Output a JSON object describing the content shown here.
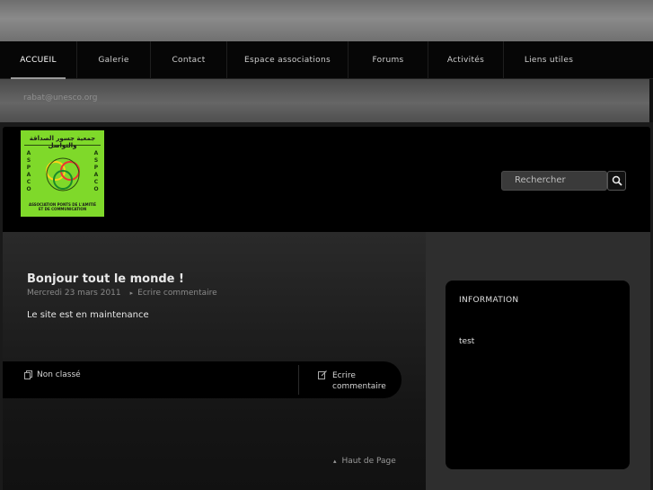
{
  "nav": {
    "items": [
      {
        "label": "ACCUEIL",
        "active": true
      },
      {
        "label": "Galerie",
        "active": false
      },
      {
        "label": "Contact",
        "active": false
      },
      {
        "label": "Espace associations",
        "active": false
      },
      {
        "label": "Forums",
        "active": false
      },
      {
        "label": "Activités",
        "active": false
      },
      {
        "label": "Liens utiles",
        "active": false
      }
    ]
  },
  "infobar": {
    "email": "rabat@unesco.org"
  },
  "logo": {
    "arabic_text": "جمعية جسور الصداقة والتواصل",
    "left_vertical": "ASPACO",
    "right_vertical": "ASPACO",
    "caption": "ASSOCIATION PONTS DE L'AMITIÉ ET DE COMMUNICATION",
    "background_color": "#7fd92a"
  },
  "search": {
    "placeholder": "Rechercher",
    "button_icon": "search-icon"
  },
  "post": {
    "title": "Bonjour tout le monde !",
    "date": "Mercredi 23 mars 2011",
    "comment_meta": "Ecrire commentaire",
    "body": "Le site est en maintenance",
    "category": "Non classé",
    "comment_link_line1": "Ecrire",
    "comment_link_line2": "commentaire"
  },
  "footer": {
    "back_to_top": "Haut de Page"
  },
  "sidebar": {
    "widget_title": "INFORMATION",
    "widget_text": "test"
  }
}
